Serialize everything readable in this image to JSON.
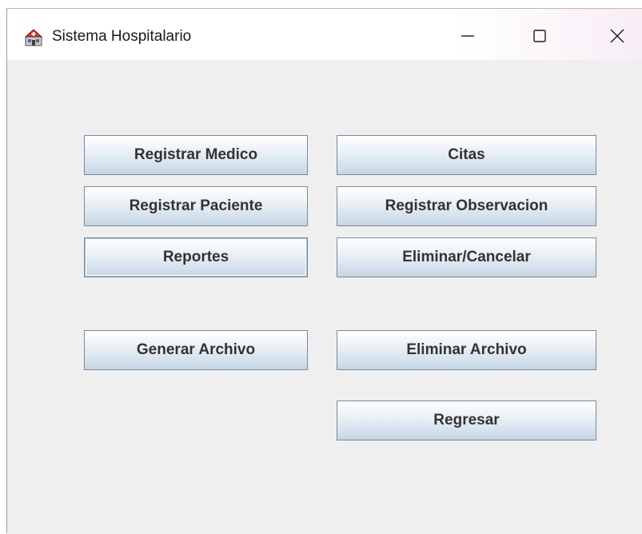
{
  "window": {
    "title": "Sistema Hospitalario",
    "controls": {
      "minimize": "—",
      "maximize": "☐",
      "close": "✕"
    }
  },
  "buttons": {
    "registrar_medico": "Registrar Medico",
    "citas": "Citas",
    "registrar_paciente": "Registrar Paciente",
    "registrar_observacion": "Registrar Observacion",
    "reportes": "Reportes",
    "eliminar_cancelar": "Eliminar/Cancelar",
    "generar_archivo": "Generar Archivo",
    "eliminar_archivo": "Eliminar Archivo",
    "regresar": "Regresar"
  },
  "focused_button": "reportes",
  "icons": {
    "app": "hospital-app-icon"
  }
}
